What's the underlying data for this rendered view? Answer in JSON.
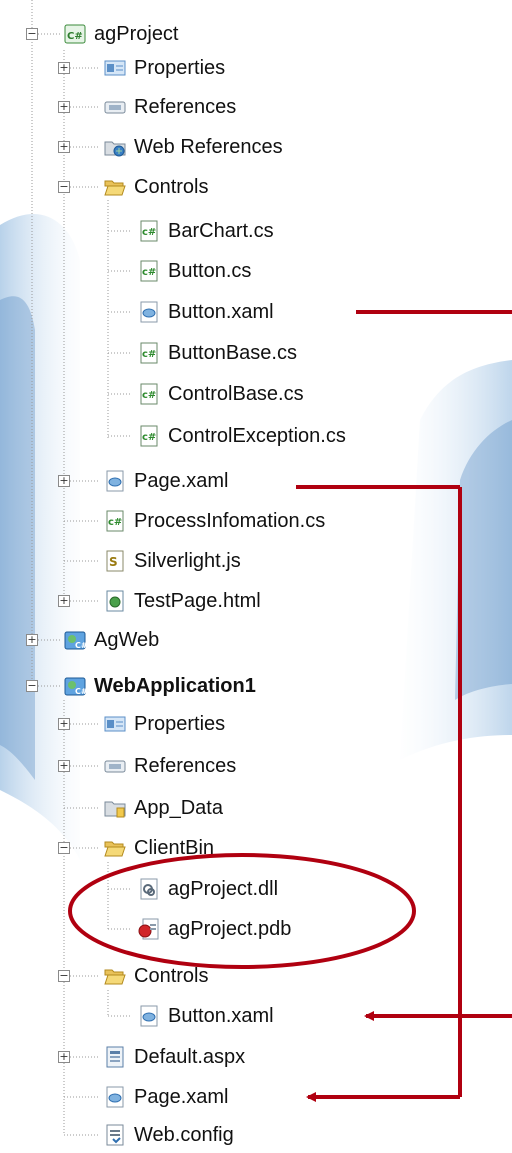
{
  "tree": {
    "ag_project": {
      "label": "agProject",
      "properties": "Properties",
      "references": "References",
      "web_references": "Web References",
      "controls": "Controls",
      "bar_chart": "BarChart.cs",
      "button_cs": "Button.cs",
      "button_xaml": "Button.xaml",
      "button_base": "ButtonBase.cs",
      "control_base": "ControlBase.cs",
      "control_exception": "ControlException.cs",
      "page_xaml": "Page.xaml",
      "process_info": "ProcessInfomation.cs",
      "silverlight_js": "Silverlight.js",
      "test_page": "TestPage.html"
    },
    "ag_web": {
      "label": "AgWeb"
    },
    "web_application1": {
      "label": "WebApplication1",
      "properties": "Properties",
      "references": "References",
      "app_data": "App_Data",
      "client_bin": "ClientBin",
      "ag_dll": "agProject.dll",
      "ag_pdb": "agProject.pdb",
      "controls": "Controls",
      "button_xaml": "Button.xaml",
      "default_aspx": "Default.aspx",
      "page_xaml": "Page.xaml",
      "web_config": "Web.config"
    }
  },
  "colors": {
    "annotation_red": "#b00010",
    "folder_yellow": "#f2c94c",
    "csharp_green": "#2e8b2e",
    "background_blue": "#a9cbe6"
  }
}
